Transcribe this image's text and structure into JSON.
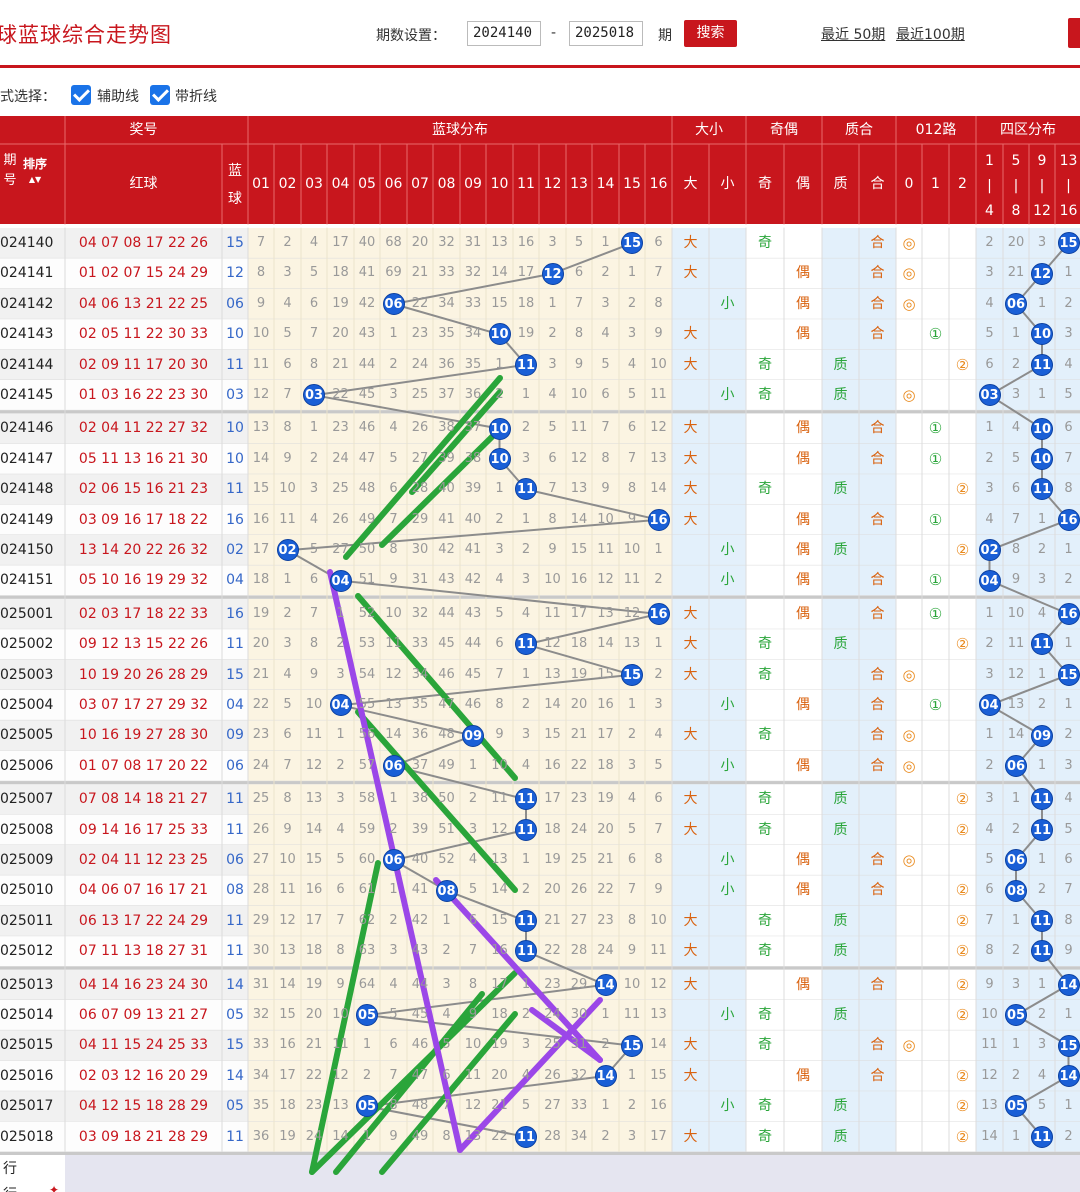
{
  "title": "球蓝球综合走势图",
  "search_bar": {
    "period_label": "期数设置：",
    "start_value": "2024140",
    "dash": "-",
    "end_value": "2025018",
    "unit_label": "期",
    "search_button": "搜索",
    "recent50": "最近 50期",
    "recent100": "最近100期"
  },
  "options": {
    "mode_label": "式选择：",
    "aux_label": "辅助线",
    "line_label": "带折线",
    "aux_checked": true,
    "line_checked": true
  },
  "header": {
    "group_award": "奖号",
    "group_blue": "蓝球分布",
    "group_bigsmall": "大小",
    "group_oddeven": "奇偶",
    "group_primecomp": "质合",
    "group_012": "012路",
    "group_zone": "四区分布",
    "col_period_top": "期",
    "col_period_bottom": "号",
    "col_sort": "排序",
    "col_red": "红球",
    "col_blue_top": "蓝",
    "col_blue_bottom": "球",
    "blue_numbers": [
      "01",
      "02",
      "03",
      "04",
      "05",
      "06",
      "07",
      "08",
      "09",
      "10",
      "11",
      "12",
      "13",
      "14",
      "15",
      "16"
    ],
    "bigsmall": [
      "大",
      "小"
    ],
    "oddeven": [
      "奇",
      "偶"
    ],
    "primecomp": [
      "质",
      "合"
    ],
    "r012": [
      "0",
      "1",
      "2"
    ],
    "zones": [
      [
        "1",
        "|",
        "4"
      ],
      [
        "5",
        "|",
        "8"
      ],
      [
        "9",
        "|",
        "12"
      ],
      [
        "13",
        "|",
        "16"
      ]
    ]
  },
  "colors": {
    "red": "#c8161d",
    "blue_ball": "#1a5fd6",
    "green_ann": "#2aa53a",
    "purple_ann": "#9b47e8",
    "zero_mark": "#e98a1e",
    "one_mark": "#2aa53a",
    "two_mark": "#e98a1e"
  },
  "icons": {
    "sort": "sort-arrows-icon",
    "check": "checkbox-checked-icon"
  },
  "rows": [
    {
      "period": "024140",
      "red": "04 07 08 17 22 26",
      "blue": "15",
      "miss": [
        "7",
        "2",
        "4",
        "17",
        "40",
        "68",
        "20",
        "32",
        "31",
        "13",
        "16",
        "3",
        "5",
        "1",
        "15",
        "6"
      ],
      "bs": "大",
      "oe": "奇",
      "pc": "合",
      "r012": "◎",
      "zone": [
        "2",
        "20",
        "3",
        "15"
      ]
    },
    {
      "period": "024141",
      "red": "01 02 07 15 24 29",
      "blue": "12",
      "miss": [
        "8",
        "3",
        "5",
        "18",
        "41",
        "69",
        "21",
        "33",
        "32",
        "14",
        "17",
        "12",
        "6",
        "2",
        "1",
        "7"
      ],
      "bs": "大",
      "oe": "偶",
      "pc": "合",
      "r012": "◎",
      "zone": [
        "3",
        "21",
        "12",
        "1"
      ]
    },
    {
      "period": "024142",
      "red": "04 06 13 21 22 25",
      "blue": "06",
      "miss": [
        "9",
        "4",
        "6",
        "19",
        "42",
        "6",
        "22",
        "34",
        "33",
        "15",
        "18",
        "1",
        "7",
        "3",
        "2",
        "8"
      ],
      "bs": "小",
      "oe": "偶",
      "pc": "合",
      "r012": "◎",
      "zone": [
        "4",
        "06",
        "1",
        "2"
      ]
    },
    {
      "period": "024143",
      "red": "02 05 11 22 30 33",
      "blue": "10",
      "miss": [
        "10",
        "5",
        "7",
        "20",
        "43",
        "1",
        "23",
        "35",
        "34",
        "10",
        "19",
        "2",
        "8",
        "4",
        "3",
        "9"
      ],
      "bs": "大",
      "oe": "偶",
      "pc": "合",
      "r012": "①",
      "zone": [
        "5",
        "1",
        "10",
        "3"
      ]
    },
    {
      "period": "024144",
      "red": "02 09 11 17 20 30",
      "blue": "11",
      "miss": [
        "11",
        "6",
        "8",
        "21",
        "44",
        "2",
        "24",
        "36",
        "35",
        "1",
        "11",
        "3",
        "9",
        "5",
        "4",
        "10"
      ],
      "bs": "大",
      "oe": "奇",
      "pc": "质",
      "r012": "②",
      "zone": [
        "6",
        "2",
        "11",
        "4"
      ]
    },
    {
      "period": "024145",
      "red": "01 03 16 22 23 30",
      "blue": "03",
      "miss": [
        "12",
        "7",
        "3",
        "22",
        "45",
        "3",
        "25",
        "37",
        "36",
        "2",
        "1",
        "4",
        "10",
        "6",
        "5",
        "11"
      ],
      "bs": "小",
      "oe": "奇",
      "pc": "质",
      "r012": "◎",
      "zone": [
        "03",
        "3",
        "1",
        "5"
      ]
    },
    {
      "period": "024146",
      "red": "02 04 11 22 27 32",
      "blue": "10",
      "miss": [
        "13",
        "8",
        "1",
        "23",
        "46",
        "4",
        "26",
        "38",
        "37",
        "10",
        "2",
        "5",
        "11",
        "7",
        "6",
        "12"
      ],
      "bs": "大",
      "oe": "偶",
      "pc": "合",
      "r012": "①",
      "zone": [
        "1",
        "4",
        "10",
        "6"
      ]
    },
    {
      "period": "024147",
      "red": "05 11 13 16 21 30",
      "blue": "10",
      "miss": [
        "14",
        "9",
        "2",
        "24",
        "47",
        "5",
        "27",
        "39",
        "38",
        "10",
        "3",
        "6",
        "12",
        "8",
        "7",
        "13"
      ],
      "bs": "大",
      "oe": "偶",
      "pc": "合",
      "r012": "①",
      "zone": [
        "2",
        "5",
        "10",
        "7"
      ]
    },
    {
      "period": "024148",
      "red": "02 06 15 16 21 23",
      "blue": "11",
      "miss": [
        "15",
        "10",
        "3",
        "25",
        "48",
        "6",
        "28",
        "40",
        "39",
        "1",
        "11",
        "7",
        "13",
        "9",
        "8",
        "14"
      ],
      "bs": "大",
      "oe": "奇",
      "pc": "质",
      "r012": "②",
      "zone": [
        "3",
        "6",
        "11",
        "8"
      ]
    },
    {
      "period": "024149",
      "red": "03 09 16 17 18 22",
      "blue": "16",
      "miss": [
        "16",
        "11",
        "4",
        "26",
        "49",
        "7",
        "29",
        "41",
        "40",
        "2",
        "1",
        "8",
        "14",
        "10",
        "9",
        "16"
      ],
      "bs": "大",
      "oe": "偶",
      "pc": "合",
      "r012": "①",
      "zone": [
        "4",
        "7",
        "1",
        "16"
      ]
    },
    {
      "period": "024150",
      "red": "13 14 20 22 26 32",
      "blue": "02",
      "miss": [
        "17",
        "2",
        "5",
        "27",
        "50",
        "8",
        "30",
        "42",
        "41",
        "3",
        "2",
        "9",
        "15",
        "11",
        "10",
        "1"
      ],
      "bs": "小",
      "oe": "偶",
      "pc": "质",
      "r012": "②",
      "zone": [
        "02",
        "8",
        "2",
        "1"
      ]
    },
    {
      "period": "024151",
      "red": "05 10 16 19 29 32",
      "blue": "04",
      "miss": [
        "18",
        "1",
        "6",
        "4",
        "51",
        "9",
        "31",
        "43",
        "42",
        "4",
        "3",
        "10",
        "16",
        "12",
        "11",
        "2"
      ],
      "bs": "小",
      "oe": "偶",
      "pc": "合",
      "r012": "①",
      "zone": [
        "04",
        "9",
        "3",
        "2"
      ]
    },
    {
      "period": "025001",
      "red": "02 03 17 18 22 33",
      "blue": "16",
      "miss": [
        "19",
        "2",
        "7",
        "1",
        "52",
        "10",
        "32",
        "44",
        "43",
        "5",
        "4",
        "11",
        "17",
        "13",
        "12",
        "16"
      ],
      "bs": "大",
      "oe": "偶",
      "pc": "合",
      "r012": "①",
      "zone": [
        "1",
        "10",
        "4",
        "16"
      ]
    },
    {
      "period": "025002",
      "red": "09 12 13 15 22 26",
      "blue": "11",
      "miss": [
        "20",
        "3",
        "8",
        "2",
        "53",
        "11",
        "33",
        "45",
        "44",
        "6",
        "11",
        "12",
        "18",
        "14",
        "13",
        "1"
      ],
      "bs": "大",
      "oe": "奇",
      "pc": "质",
      "r012": "②",
      "zone": [
        "2",
        "11",
        "11",
        "1"
      ]
    },
    {
      "period": "025003",
      "red": "10 19 20 26 28 29",
      "blue": "15",
      "miss": [
        "21",
        "4",
        "9",
        "3",
        "54",
        "12",
        "34",
        "46",
        "45",
        "7",
        "1",
        "13",
        "19",
        "15",
        "15",
        "2"
      ],
      "bs": "大",
      "oe": "奇",
      "pc": "合",
      "r012": "◎",
      "zone": [
        "3",
        "12",
        "1",
        "15"
      ]
    },
    {
      "period": "025004",
      "red": "03 07 17 27 29 32",
      "blue": "04",
      "miss": [
        "22",
        "5",
        "10",
        "4",
        "55",
        "13",
        "35",
        "47",
        "46",
        "8",
        "2",
        "14",
        "20",
        "16",
        "1",
        "3"
      ],
      "bs": "小",
      "oe": "偶",
      "pc": "合",
      "r012": "①",
      "zone": [
        "04",
        "13",
        "2",
        "1"
      ]
    },
    {
      "period": "025005",
      "red": "10 16 19 27 28 30",
      "blue": "09",
      "miss": [
        "23",
        "6",
        "11",
        "1",
        "56",
        "14",
        "36",
        "48",
        "9",
        "9",
        "3",
        "15",
        "21",
        "17",
        "2",
        "4"
      ],
      "bs": "大",
      "oe": "奇",
      "pc": "合",
      "r012": "◎",
      "zone": [
        "1",
        "14",
        "09",
        "2"
      ]
    },
    {
      "period": "025006",
      "red": "01 07 08 17 20 22",
      "blue": "06",
      "miss": [
        "24",
        "7",
        "12",
        "2",
        "57",
        "6",
        "37",
        "49",
        "1",
        "10",
        "4",
        "16",
        "22",
        "18",
        "3",
        "5"
      ],
      "bs": "小",
      "oe": "偶",
      "pc": "合",
      "r012": "◎",
      "zone": [
        "2",
        "06",
        "1",
        "3"
      ]
    },
    {
      "period": "025007",
      "red": "07 08 14 18 21 27",
      "blue": "11",
      "miss": [
        "25",
        "8",
        "13",
        "3",
        "58",
        "1",
        "38",
        "50",
        "2",
        "11",
        "11",
        "17",
        "23",
        "19",
        "4",
        "6"
      ],
      "bs": "大",
      "oe": "奇",
      "pc": "质",
      "r012": "②",
      "zone": [
        "3",
        "1",
        "11",
        "4"
      ]
    },
    {
      "period": "025008",
      "red": "09 14 16 17 25 33",
      "blue": "11",
      "miss": [
        "26",
        "9",
        "14",
        "4",
        "59",
        "2",
        "39",
        "51",
        "3",
        "12",
        "11",
        "18",
        "24",
        "20",
        "5",
        "7"
      ],
      "bs": "大",
      "oe": "奇",
      "pc": "质",
      "r012": "②",
      "zone": [
        "4",
        "2",
        "11",
        "5"
      ]
    },
    {
      "period": "025009",
      "red": "02 04 11 12 23 25",
      "blue": "06",
      "miss": [
        "27",
        "10",
        "15",
        "5",
        "60",
        "6",
        "40",
        "52",
        "4",
        "13",
        "1",
        "19",
        "25",
        "21",
        "6",
        "8"
      ],
      "bs": "小",
      "oe": "偶",
      "pc": "合",
      "r012": "◎",
      "zone": [
        "5",
        "06",
        "1",
        "6"
      ]
    },
    {
      "period": "025010",
      "red": "04 06 07 16 17 21",
      "blue": "08",
      "miss": [
        "28",
        "11",
        "16",
        "6",
        "61",
        "1",
        "41",
        "8",
        "5",
        "14",
        "2",
        "20",
        "26",
        "22",
        "7",
        "9"
      ],
      "bs": "小",
      "oe": "偶",
      "pc": "合",
      "r012": "②",
      "zone": [
        "6",
        "08",
        "2",
        "7"
      ]
    },
    {
      "period": "025011",
      "red": "06 13 17 22 24 29",
      "blue": "11",
      "miss": [
        "29",
        "12",
        "17",
        "7",
        "62",
        "2",
        "42",
        "1",
        "6",
        "15",
        "11",
        "21",
        "27",
        "23",
        "8",
        "10"
      ],
      "bs": "大",
      "oe": "奇",
      "pc": "质",
      "r012": "②",
      "zone": [
        "7",
        "1",
        "11",
        "8"
      ]
    },
    {
      "period": "025012",
      "red": "07 11 13 18 27 31",
      "blue": "11",
      "miss": [
        "30",
        "13",
        "18",
        "8",
        "63",
        "3",
        "43",
        "2",
        "7",
        "16",
        "11",
        "22",
        "28",
        "24",
        "9",
        "11"
      ],
      "bs": "大",
      "oe": "奇",
      "pc": "质",
      "r012": "②",
      "zone": [
        "8",
        "2",
        "11",
        "9"
      ]
    },
    {
      "period": "025013",
      "red": "04 14 16 23 24 30",
      "blue": "14",
      "miss": [
        "31",
        "14",
        "19",
        "9",
        "64",
        "4",
        "44",
        "3",
        "8",
        "17",
        "1",
        "23",
        "29",
        "14",
        "10",
        "12"
      ],
      "bs": "大",
      "oe": "偶",
      "pc": "合",
      "r012": "②",
      "zone": [
        "9",
        "3",
        "1",
        "14"
      ]
    },
    {
      "period": "025014",
      "red": "06 07 09 13 21 27",
      "blue": "05",
      "miss": [
        "32",
        "15",
        "20",
        "10",
        "5",
        "5",
        "45",
        "4",
        "9",
        "18",
        "2",
        "24",
        "30",
        "1",
        "11",
        "13"
      ],
      "bs": "小",
      "oe": "奇",
      "pc": "质",
      "r012": "②",
      "zone": [
        "10",
        "05",
        "2",
        "1"
      ]
    },
    {
      "period": "025015",
      "red": "04 11 15 24 25 33",
      "blue": "15",
      "miss": [
        "33",
        "16",
        "21",
        "11",
        "1",
        "6",
        "46",
        "5",
        "10",
        "19",
        "3",
        "25",
        "31",
        "2",
        "15",
        "14"
      ],
      "bs": "大",
      "oe": "奇",
      "pc": "合",
      "r012": "◎",
      "zone": [
        "11",
        "1",
        "3",
        "15"
      ]
    },
    {
      "period": "025016",
      "red": "02 03 12 16 20 29",
      "blue": "14",
      "miss": [
        "34",
        "17",
        "22",
        "12",
        "2",
        "7",
        "47",
        "6",
        "11",
        "20",
        "4",
        "26",
        "32",
        "14",
        "1",
        "15"
      ],
      "bs": "大",
      "oe": "偶",
      "pc": "合",
      "r012": "②",
      "zone": [
        "12",
        "2",
        "4",
        "14"
      ]
    },
    {
      "period": "025017",
      "red": "04 12 15 18 28 29",
      "blue": "05",
      "miss": [
        "35",
        "18",
        "23",
        "13",
        "5",
        "8",
        "48",
        "7",
        "12",
        "21",
        "5",
        "27",
        "33",
        "1",
        "2",
        "16"
      ],
      "bs": "小",
      "oe": "奇",
      "pc": "质",
      "r012": "②",
      "zone": [
        "13",
        "05",
        "5",
        "1"
      ]
    },
    {
      "period": "025018",
      "red": "03 09 18 21 28 29",
      "blue": "11",
      "miss": [
        "36",
        "19",
        "24",
        "14",
        "1",
        "9",
        "49",
        "8",
        "13",
        "22",
        "11",
        "28",
        "34",
        "2",
        "3",
        "17"
      ],
      "bs": "大",
      "oe": "奇",
      "pc": "质",
      "r012": "②",
      "zone": [
        "14",
        "1",
        "11",
        "2"
      ]
    }
  ],
  "footer": {
    "row1": "行",
    "row2": "行"
  }
}
